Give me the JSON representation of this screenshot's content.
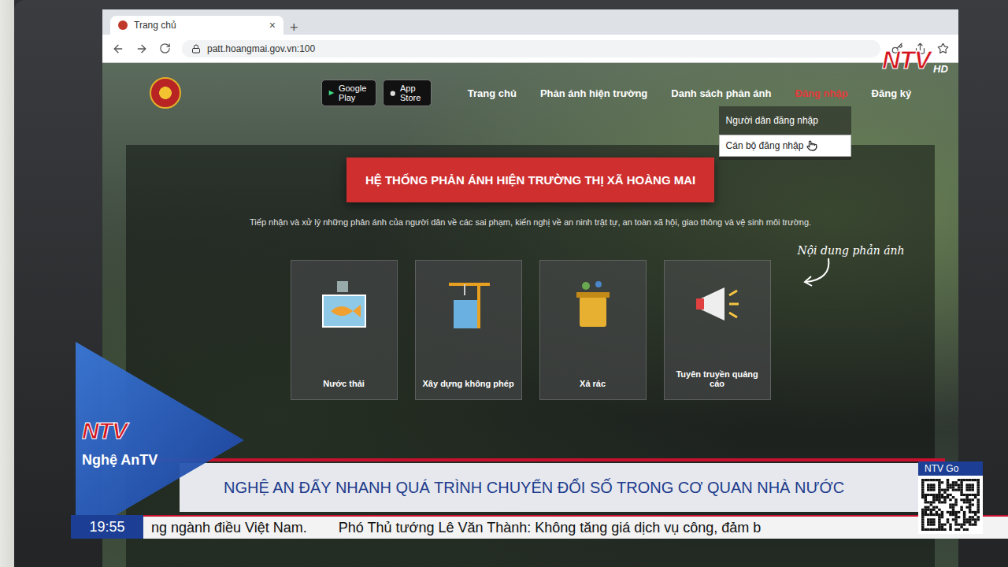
{
  "browser": {
    "tab_title": "Trang chủ",
    "tab_close": "×",
    "new_tab": "+",
    "address": "patt.hoangmai.gov.vn:100"
  },
  "site": {
    "store_badges": [
      "Google Play",
      "App Store"
    ],
    "nav": [
      {
        "label": "Trang chủ",
        "selected": false
      },
      {
        "label": "Phản ánh hiện trường",
        "selected": false
      },
      {
        "label": "Danh sách phản ánh",
        "selected": false
      },
      {
        "label": "Đăng nhập",
        "selected": true
      },
      {
        "label": "Đăng ký",
        "selected": false
      }
    ],
    "login_menu": [
      {
        "label": "Người dân đăng nhập",
        "selected": false
      },
      {
        "label": "Cán bộ đăng nhập",
        "selected": true
      }
    ],
    "banner": "HỆ THỐNG PHẢN ÁNH HIỆN TRƯỜNG THỊ XÃ HOÀNG MAI",
    "intro": "Tiếp nhận và xử lý những phản ánh của người dân về các sai phạm, kiến nghị về an ninh trật tự, an toàn xã hội, giao thông và vệ sinh môi trường.",
    "hint": "Nội dung phản ánh",
    "categories": [
      {
        "label": "Nước thải"
      },
      {
        "label": "Xây dựng không phép"
      },
      {
        "label": "Xả rác"
      },
      {
        "label": "Tuyên truyền quảng cáo"
      }
    ]
  },
  "broadcast": {
    "corner_logo": "NTV",
    "quality": "HD",
    "channel_logo": "NTV",
    "channel": "Nghệ AnTV",
    "headline": "NGHỆ AN ĐẨY NHANH QUÁ TRÌNH CHUYỂN ĐỔI SỐ TRONG CƠ QUAN NHÀ NƯỚC",
    "clock": "19:55",
    "ticker": [
      "ng ngành điều Việt Nam.",
      "Phó Thủ tướng Lê Văn Thành: Không tăng giá dịch vụ công, đảm b"
    ],
    "qr_label": "NTV Go"
  }
}
